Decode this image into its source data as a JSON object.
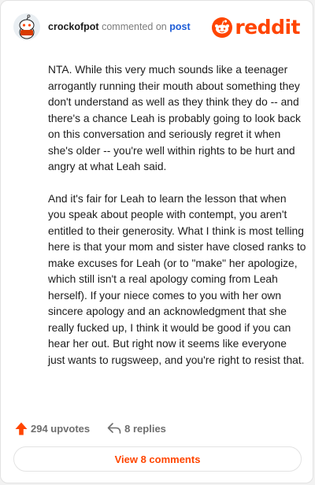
{
  "header": {
    "username": "crockofpot",
    "action_text": "commented on",
    "post_link": "post",
    "logo_text": "reddit"
  },
  "comment": {
    "paragraphs": [
      "NTA. While this very much sounds like a teenager arrogantly running their mouth about something they don't understand as well as they think they do -- and there's a chance Leah is probably going to look back on this conversation and seriously regret it when she's older -- you're well within rights to be hurt and angry at what Leah said.",
      "And it's fair for Leah to learn the lesson that when you speak about people with contempt, you aren't entitled to their generosity. What I think is most telling here is that your mom and sister have closed ranks to make excuses for Leah (or to \"make\" her apologize, which still isn't a real apology coming from Leah herself). If your niece comes to you with her own sincere apology and an acknowledgment that she really fucked up, I think it would be good if you can hear her out. But right now it seems like everyone just wants to rugsweep, and you're right to resist that."
    ]
  },
  "actions": {
    "upvotes": "294 upvotes",
    "replies": "8 replies"
  },
  "footer": {
    "view_comments": "View 8 comments"
  },
  "icons": {
    "avatar": "snoo-avatar-icon",
    "logo": "reddit-snoo-icon",
    "upvote": "upvote-arrow-icon",
    "reply": "reply-arrow-icon"
  },
  "colors": {
    "brand": "#ff4500",
    "link": "#1c5bd6",
    "text": "#1c1c1c",
    "muted": "#6e6e6e"
  }
}
